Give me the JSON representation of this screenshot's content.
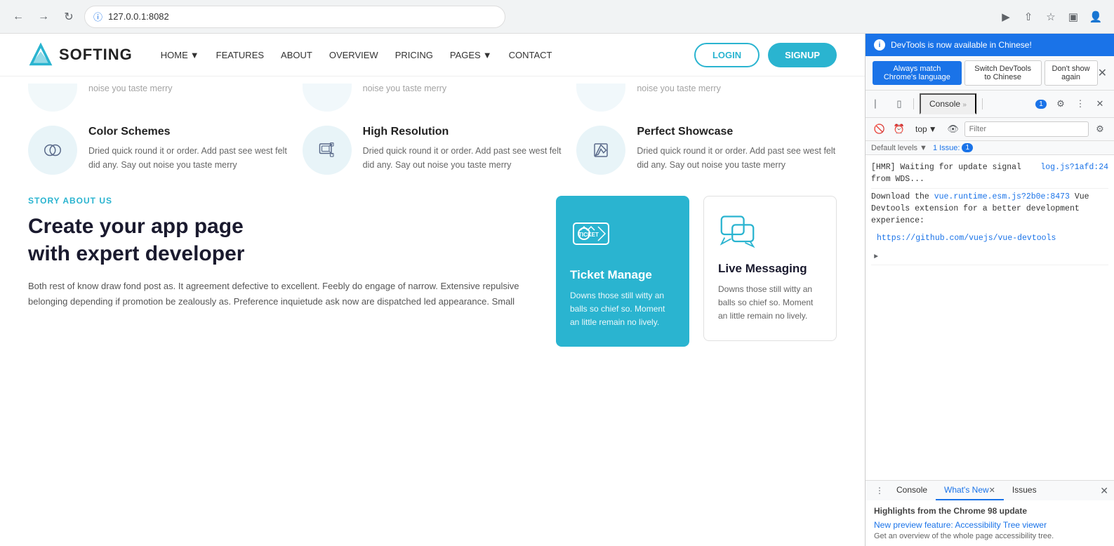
{
  "browser": {
    "url": "127.0.0.1:8082",
    "back_label": "←",
    "forward_label": "→",
    "reload_label": "↺"
  },
  "navbar": {
    "logo_text": "SOFTING",
    "nav_items": [
      {
        "label": "HOME",
        "has_dropdown": true
      },
      {
        "label": "FEATURES",
        "has_dropdown": false
      },
      {
        "label": "ABOUT",
        "has_dropdown": false
      },
      {
        "label": "OVERVIEW",
        "has_dropdown": false
      },
      {
        "label": "PRICING",
        "has_dropdown": false
      },
      {
        "label": "PAGES",
        "has_dropdown": true
      },
      {
        "label": "CONTACT",
        "has_dropdown": false
      }
    ],
    "login_label": "LOGIN",
    "signup_label": "SIGNUP"
  },
  "partial_features": [
    {
      "desc": "noise you taste merry"
    },
    {
      "desc": "noise you taste merry"
    },
    {
      "desc": "noise you taste merry"
    }
  ],
  "features": [
    {
      "title": "Color Schemes",
      "desc": "Dried quick round it or order. Add past see west felt did any. Say out noise you taste merry",
      "icon": "color-schemes"
    },
    {
      "title": "High Resolution",
      "desc": "Dried quick round it or order. Add past see west felt did any. Say out noise you taste merry",
      "icon": "high-resolution"
    },
    {
      "title": "Perfect Showcase",
      "desc": "Dried quick round it or order. Add past see west felt did any. Say out noise you taste merry",
      "icon": "perfect-showcase"
    }
  ],
  "story": {
    "tag": "STORY ABOUT US",
    "title": "Create your app page\nwith expert developer",
    "text": "Both rest of know draw fond post as. It agreement defective to excellent. Feebly do engage of narrow. Extensive repulsive belonging depending if promotion be zealously as. Preference inquietude ask now are dispatched led appearance. Small"
  },
  "cards": [
    {
      "type": "ticket",
      "title": "Ticket Manage",
      "desc": "Downs those still witty an balls so chief so. Moment an little remain no lively."
    },
    {
      "type": "messaging",
      "title": "Live Messaging",
      "desc": "Downs those still witty an balls so chief so. Moment an little remain no lively."
    }
  ],
  "devtools": {
    "notification_text": "DevTools is now available in Chinese!",
    "lang_btn1": "Always match Chrome's language",
    "lang_btn2": "Switch DevTools to Chinese",
    "dont_show": "Don't show again",
    "console_tab": "Console",
    "console_chevron": "»",
    "badge": "1",
    "filter_placeholder": "Filter",
    "top_label": "top",
    "default_levels": "Default levels",
    "issues_label": "1 Issue:",
    "issues_badge": "1",
    "console_entries": [
      {
        "text": "[HMR] Waiting for update signal from WDS...",
        "link_text": "log.js?1afd:24",
        "link_url": "#"
      },
      {
        "text": "Download the vue.runtime.esm.js?2b0e:8473 Vue Devtools extension for a better development experience:",
        "link_text": "https://github.com/vuejs/vue-devtools",
        "link_url": "#",
        "has_expand": true
      }
    ],
    "bottom_tabs": [
      {
        "label": "Console",
        "active": false,
        "closeable": false
      },
      {
        "label": "What's New",
        "active": true,
        "closeable": true
      },
      {
        "label": "Issues",
        "active": false,
        "closeable": false
      }
    ],
    "whatsnew_title": "Highlights from the Chrome 98 update",
    "whatsnew_link": "New preview feature: Accessibility Tree viewer",
    "whatsnew_desc": "Get an overview of the whole page accessibility tree."
  }
}
